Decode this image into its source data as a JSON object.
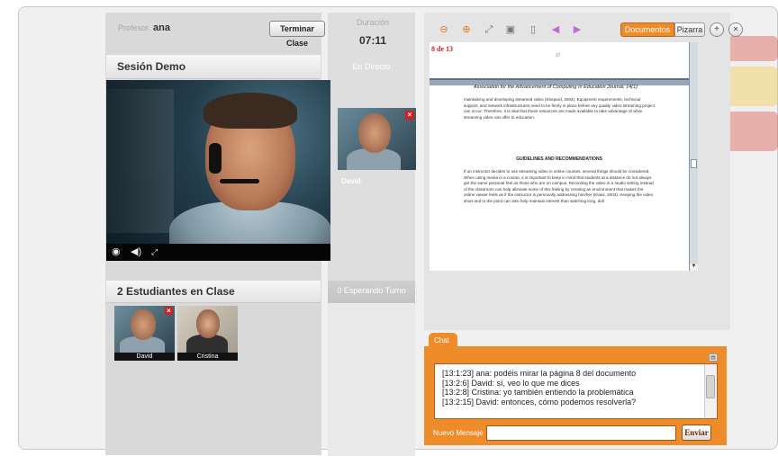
{
  "header": {
    "teacher_label": "Profesor",
    "teacher_name": "ana",
    "end_class_button": "Terminar Clase",
    "duration_label": "Duración",
    "duration_value": "07:11"
  },
  "session": {
    "title": "Sesión Demo",
    "live_label": "En Directo"
  },
  "live_participant": {
    "name": "David"
  },
  "students": {
    "title": "2 Estudiantes en Clase",
    "waiting_title": "0 Esperando Turno",
    "items": [
      {
        "name": "David"
      },
      {
        "name": "Cristina"
      }
    ]
  },
  "toolbar": {
    "tab_documents": "Documentos",
    "tab_board": "Pizarra"
  },
  "document": {
    "page_counter": "8 de 13",
    "prev_page_number": "37",
    "running_header": "Association for the Advancement of Computing In Education Journal, 14(1)",
    "para1": "maintaining and developing streamed video (Shepard, 2004). Equipment requirements, technical support, and network infrastructures need to be firmly in place before any quality video streaming project can occur. Therefore, it is vital that these resources are made available to take advantage of what streaming video can offer to education.",
    "section_title": "GUIDELINES AND RECOMMENDATIONS",
    "para2": "If an instructor decides to use streaming video in online courses, several things should be considered. When using media in a course, it is important to keep in mind that students at a distance do not always get the same personal feel as those who are on campus. Recording the video in a studio setting instead of the classroom can help alleviate some of this feeling by creating an environment that makes the online viewer feels as if the instructor is personally addressing him/her (Klass, 2003). Keeping the video short and to the point can also help maintain interest than watching long, dull"
  },
  "chat": {
    "tab_label": "Chat",
    "messages": [
      {
        "text": "[13:1:23]  ana: podéis mirar la página 8 del documento"
      },
      {
        "text": "[13:2:6]  David: sí, veo lo que me dices"
      },
      {
        "text": "[13:2:8]  Cristina: yo también entiendo la problemática"
      },
      {
        "text": "[13:2:15]  David: entonces, cómo podemos resolverla?"
      }
    ],
    "new_message_label": "Nuevo Mensaje",
    "new_message_value": "",
    "send_button": "Enviar"
  },
  "colors": {
    "accent": "#ef8c2a",
    "close": "#d21f1f",
    "page_counter": "#d02020"
  }
}
